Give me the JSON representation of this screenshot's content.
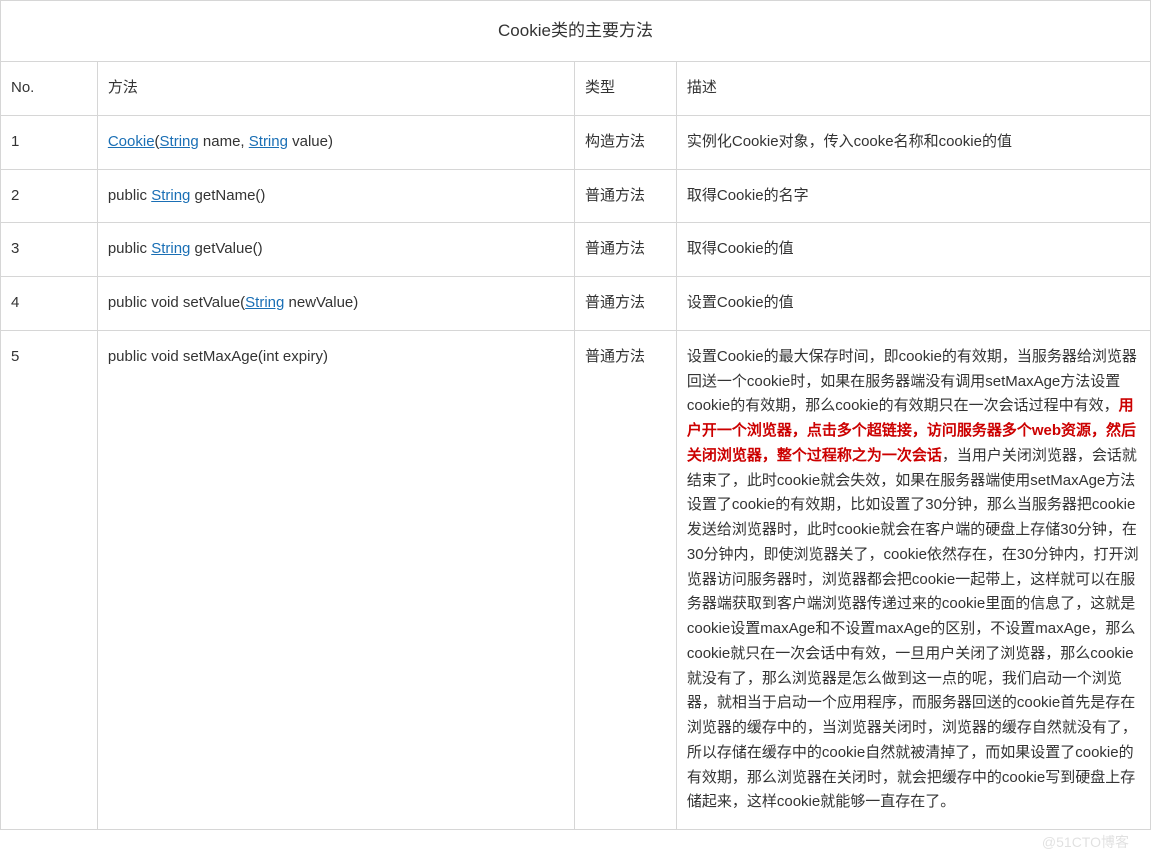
{
  "title": "Cookie类的主要方法",
  "headers": {
    "no": "No.",
    "method": "方法",
    "type": "类型",
    "desc": "描述"
  },
  "rows": [
    {
      "no": "1",
      "method_parts": [
        {
          "kind": "link",
          "t": "Cookie"
        },
        {
          "kind": "text",
          "t": "("
        },
        {
          "kind": "link",
          "t": "String"
        },
        {
          "kind": "text",
          "t": " name, "
        },
        {
          "kind": "link",
          "t": "String"
        },
        {
          "kind": "text",
          "t": " value)"
        }
      ],
      "type": "构造方法",
      "desc_parts": [
        {
          "kind": "text",
          "t": "实例化Cookie对象，传入cooke名称和cookie的值"
        }
      ]
    },
    {
      "no": "2",
      "method_parts": [
        {
          "kind": "text",
          "t": "public "
        },
        {
          "kind": "link",
          "t": "String"
        },
        {
          "kind": "text",
          "t": " getName()"
        }
      ],
      "type": "普通方法",
      "desc_parts": [
        {
          "kind": "text",
          "t": "取得Cookie的名字"
        }
      ]
    },
    {
      "no": "3",
      "method_parts": [
        {
          "kind": "text",
          "t": "public "
        },
        {
          "kind": "link",
          "t": "String"
        },
        {
          "kind": "text",
          "t": " getValue()"
        }
      ],
      "type": "普通方法",
      "desc_parts": [
        {
          "kind": "text",
          "t": "取得Cookie的值"
        }
      ]
    },
    {
      "no": "4",
      "method_parts": [
        {
          "kind": "text",
          "t": "public void setValue("
        },
        {
          "kind": "link",
          "t": "String"
        },
        {
          "kind": "text",
          "t": " newValue)"
        }
      ],
      "type": "普通方法",
      "desc_parts": [
        {
          "kind": "text",
          "t": "设置Cookie的值"
        }
      ]
    },
    {
      "no": "5",
      "method_parts": [
        {
          "kind": "text",
          "t": "public void setMaxAge(int expiry)"
        }
      ],
      "type": "普通方法",
      "desc_parts": [
        {
          "kind": "text",
          "t": "设置Cookie的最大保存时间，即cookie的有效期，当服务器给浏览器回送一个cookie时，如果在服务器端没有调用setMaxAge方法设置cookie的有效期，那么cookie的有效期只在一次会话过程中有效，"
        },
        {
          "kind": "red",
          "t": "用户开一个浏览器，点击多个超链接，访问服务器多个web资源，然后关闭浏览器，整个过程称之为一次会话"
        },
        {
          "kind": "text",
          "t": "，当用户关闭浏览器，会话就结束了，此时cookie就会失效，如果在服务器端使用setMaxAge方法设置了cookie的有效期，比如设置了30分钟，那么当服务器把cookie发送给浏览器时，此时cookie就会在客户端的硬盘上存储30分钟，在30分钟内，即使浏览器关了，cookie依然存在，在30分钟内，打开浏览器访问服务器时，浏览器都会把cookie一起带上，这样就可以在服务器端获取到客户端浏览器传递过来的cookie里面的信息了，这就是cookie设置maxAge和不设置maxAge的区别，不设置maxAge，那么cookie就只在一次会话中有效，一旦用户关闭了浏览器，那么cookie就没有了，那么浏览器是怎么做到这一点的呢，我们启动一个浏览器，就相当于启动一个应用程序，而服务器回送的cookie首先是存在浏览器的缓存中的，当浏览器关闭时，浏览器的缓存自然就没有了，所以存储在缓存中的cookie自然就被清掉了，而如果设置了cookie的有效期，那么浏览器在关闭时，就会把缓存中的cookie写到硬盘上存储起来，这样cookie就能够一直存在了。"
        }
      ]
    }
  ],
  "watermark": "@51CTO博客"
}
